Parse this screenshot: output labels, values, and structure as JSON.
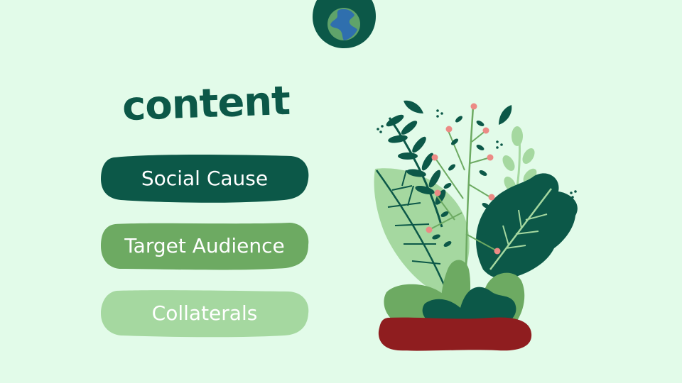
{
  "title": "content",
  "items": [
    {
      "label": "Social Cause",
      "color": "#0c5848"
    },
    {
      "label": "Target Audience",
      "color": "#6daa62"
    },
    {
      "label": "Collaterals",
      "color": "#a5d8a0"
    }
  ],
  "icons": {
    "badge": "globe-icon",
    "illustration": "plant-illustration"
  },
  "colors": {
    "background": "#e2fbe9",
    "dark_green": "#0c5848",
    "mid_green": "#6daa62",
    "light_green": "#a5d8a0",
    "pot_red": "#8f1d1f",
    "berry_pink": "#ec8a85"
  }
}
